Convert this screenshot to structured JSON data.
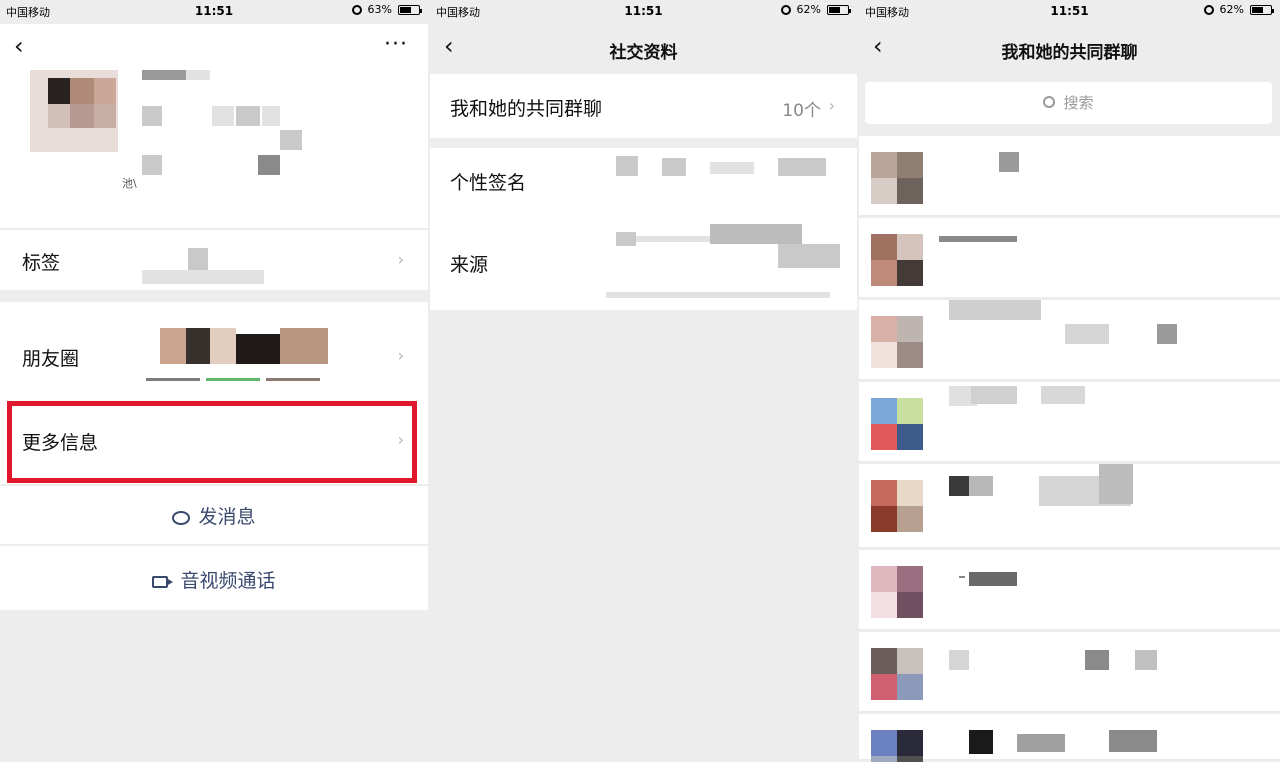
{
  "status": {
    "carrier": "中国移动",
    "time": "11:51",
    "panels": [
      {
        "battery": "63%",
        "battery_level": 0.63
      },
      {
        "battery": "62%",
        "battery_level": 0.62
      },
      {
        "battery": "62%",
        "battery_level": 0.62
      }
    ]
  },
  "profile": {
    "nickname_suffix": "池\\",
    "rows": {
      "tag_label": "标签",
      "moments_label": "朋友圈",
      "more_info_label": "更多信息"
    },
    "actions": {
      "send_message": "发消息",
      "av_call": "音视频通话"
    }
  },
  "social": {
    "title": "社交资料",
    "common_groups_label": "我和她的共同群聊",
    "common_groups_count": "10个",
    "signature_label": "个性签名",
    "source_label": "来源"
  },
  "groups": {
    "title": "我和她的共同群聊",
    "search_placeholder": "搜索",
    "count_rows": 8
  },
  "colors": {
    "highlight": "#e0182d",
    "action_text": "#3a4a6e",
    "background": "#ededed"
  }
}
